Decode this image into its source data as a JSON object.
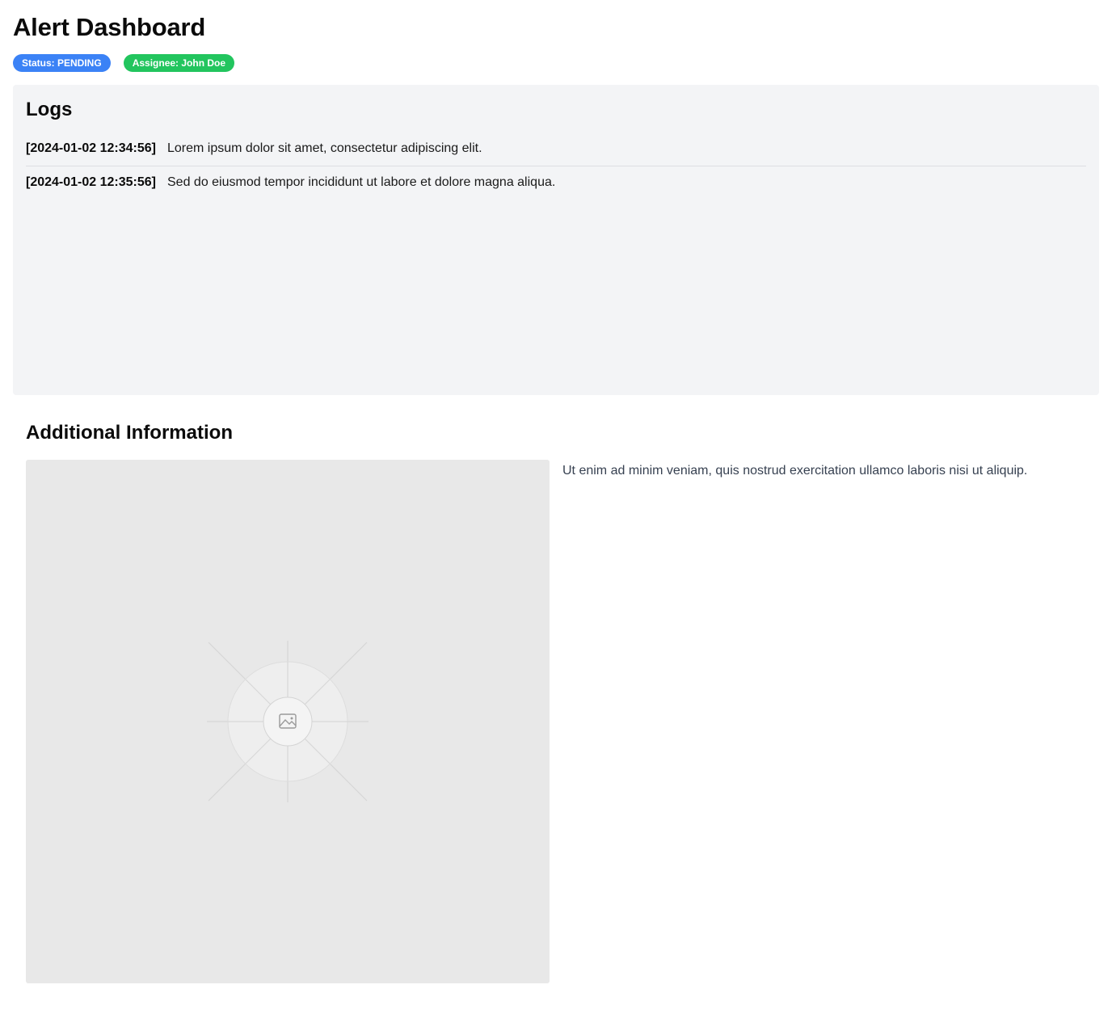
{
  "header": {
    "title": "Alert Dashboard",
    "badges": {
      "status": "Status: PENDING",
      "assignee": "Assignee: John Doe"
    }
  },
  "logs": {
    "title": "Logs",
    "entries": [
      {
        "time": "[2024-01-02 12:34:56]",
        "message": "Lorem ipsum dolor sit amet, consectetur adipiscing elit."
      },
      {
        "time": "[2024-01-02 12:35:56]",
        "message": "Sed do eiusmod tempor incididunt ut labore et dolore magna aliqua."
      }
    ]
  },
  "additional": {
    "title": "Additional Information",
    "image_icon": "image-placeholder-icon",
    "text": "Ut enim ad minim veniam, quis nostrud exercitation ullamco laboris nisi ut aliquip."
  },
  "colors": {
    "status_badge": "#3b82f6",
    "assignee_badge": "#22c55e",
    "panel_background": "#f3f4f6",
    "image_placeholder": "#e8e8e8"
  }
}
